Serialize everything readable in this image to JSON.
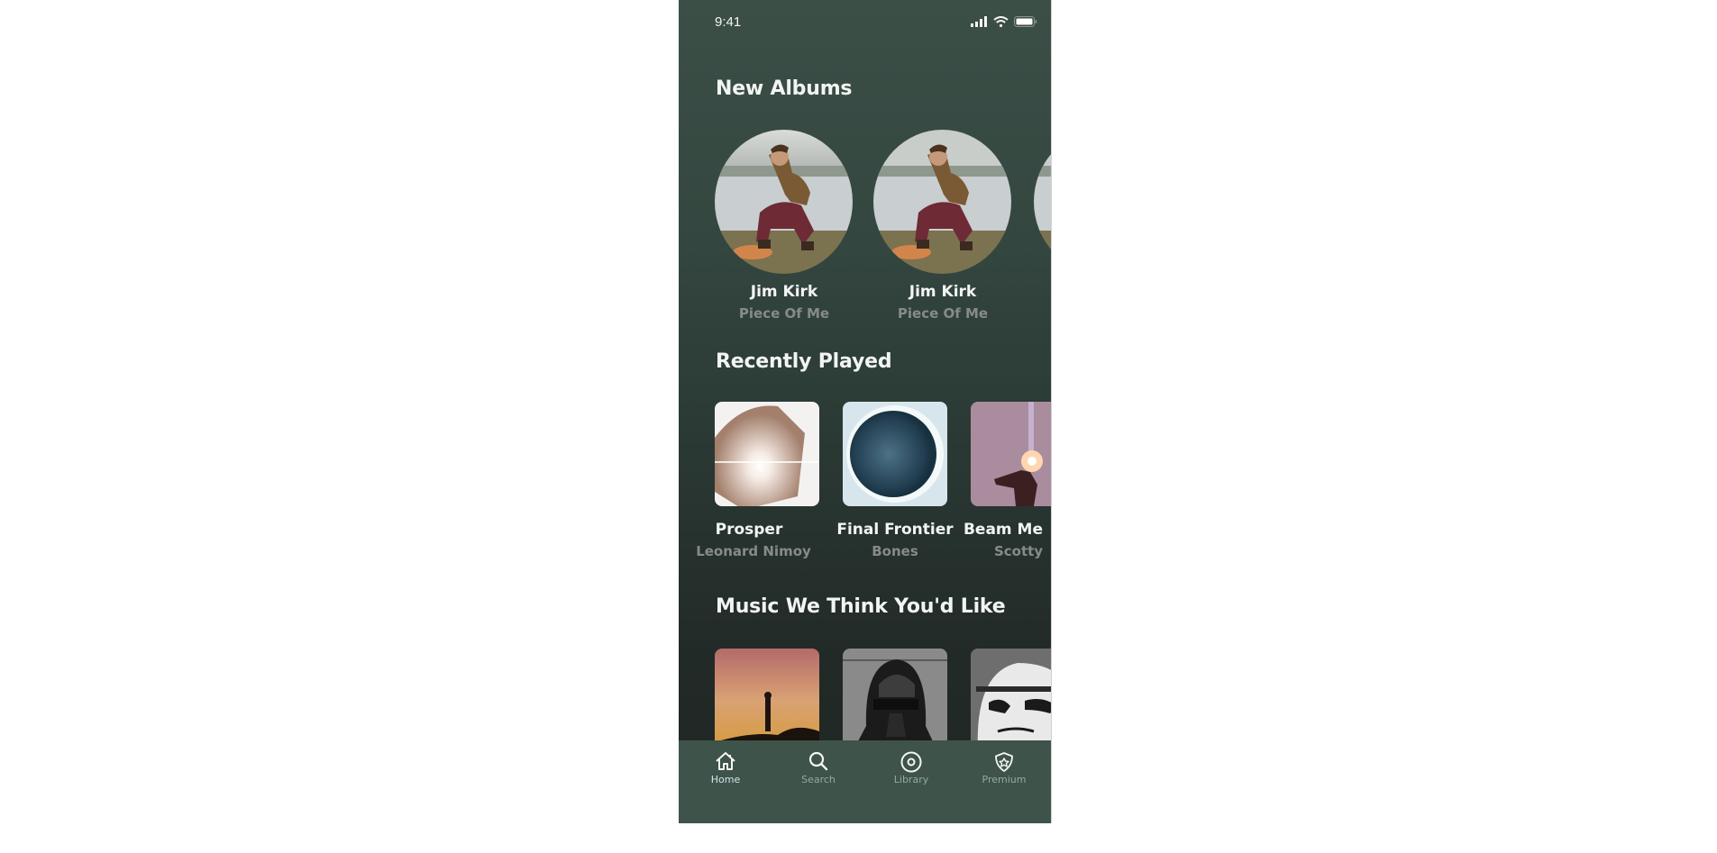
{
  "status_bar": {
    "time": "9:41",
    "icons": [
      "signal-icon",
      "wifi-icon",
      "battery-icon"
    ]
  },
  "sections": {
    "new_albums": {
      "title": "New Albums",
      "items": [
        {
          "title": "Jim Kirk",
          "subtitle": "Piece Of Me",
          "art": "man-crouching-by-lake"
        },
        {
          "title": "Jim Kirk",
          "subtitle": "Piece Of Me",
          "art": "man-crouching-by-lake"
        },
        {
          "title": "",
          "subtitle": "",
          "art": "man-crouching-by-lake"
        }
      ]
    },
    "recently_played": {
      "title": "Recently Played",
      "items": [
        {
          "title": "Prosper",
          "subtitle": "Leonard Nimoy",
          "art": "hands-with-light"
        },
        {
          "title": "Final Frontier",
          "subtitle": "Bones",
          "art": "eclipse"
        },
        {
          "title": "Beam Me",
          "subtitle": "Scotty",
          "art": "person-with-light-under-stars"
        }
      ]
    },
    "recommended": {
      "title": "Music We Think You'd Like",
      "items": [
        {
          "art": "silhouette-under-milky-way"
        },
        {
          "art": "darth-vader-helmet"
        },
        {
          "art": "stormtrooper-helmet"
        }
      ]
    }
  },
  "nav": {
    "items": [
      {
        "label": "Home",
        "icon": "home-icon",
        "active": true
      },
      {
        "label": "Search",
        "icon": "search-icon",
        "active": false
      },
      {
        "label": "Library",
        "icon": "library-icon",
        "active": false
      },
      {
        "label": "Premium",
        "icon": "premium-icon",
        "active": false
      }
    ],
    "active_color": "#d3e6ea",
    "inactive_color": "#93aaa2"
  },
  "colors": {
    "background_top": "#3c4f47",
    "background_bottom": "#1f2624",
    "nav_background": "#3e534a",
    "title_text": "#f2f4f3",
    "subtitle_text": "#868b89"
  }
}
